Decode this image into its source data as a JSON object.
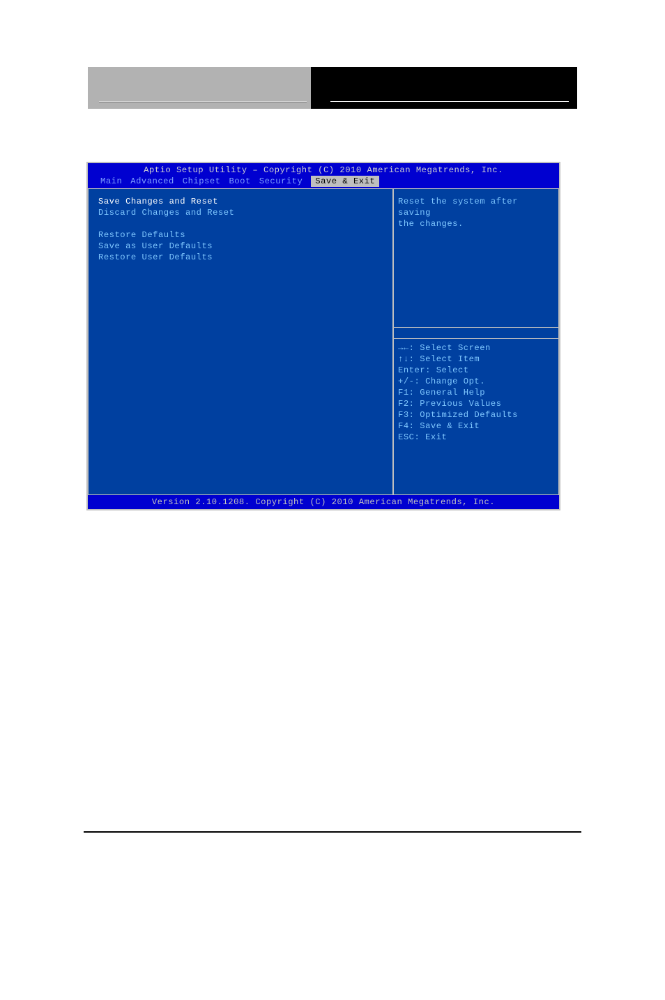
{
  "bios": {
    "title": "Aptio Setup Utility – Copyright (C) 2010 American Megatrends, Inc.",
    "tabs": [
      "Main",
      "Advanced",
      "Chipset",
      "Boot",
      "Security",
      "Save & Exit"
    ],
    "active_tab_index": 5,
    "menu": {
      "selected": "Save Changes and Reset",
      "items_group1": [
        "Save Changes and Reset",
        "Discard Changes and Reset"
      ],
      "items_group2": [
        "Restore Defaults",
        "Save as User Defaults",
        "Restore User Defaults"
      ]
    },
    "help_description": [
      "Reset the system after saving",
      "the changes."
    ],
    "key_legend": [
      "→←: Select Screen",
      "↑↓: Select Item",
      "Enter: Select",
      "+/-: Change Opt.",
      "F1: General Help",
      "F2: Previous Values",
      "F3: Optimized Defaults",
      "F4: Save & Exit",
      "ESC: Exit"
    ],
    "footer": "Version 2.10.1208. Copyright (C) 2010 American Megatrends, Inc."
  }
}
